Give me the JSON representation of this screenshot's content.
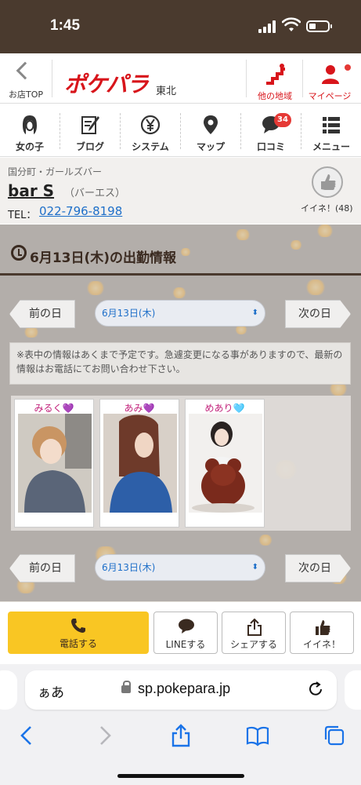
{
  "status_bar": {
    "time": "1:45"
  },
  "header": {
    "back_label": "お店TOP",
    "logo": "ポケパラ",
    "region": "東北",
    "other_region_label": "他の地域",
    "mypage_label": "マイページ"
  },
  "nav": {
    "items": [
      {
        "label": "女の子",
        "icon": "girl-icon"
      },
      {
        "label": "ブログ",
        "icon": "blog-icon"
      },
      {
        "label": "システム",
        "icon": "yen-icon"
      },
      {
        "label": "マップ",
        "icon": "map-pin-icon"
      },
      {
        "label": "口コミ",
        "icon": "chat-bubble-icon",
        "badge": "34"
      },
      {
        "label": "メニュー",
        "icon": "menu-list-icon"
      }
    ]
  },
  "shop": {
    "category": "国分町・ガールズバー",
    "name": "bar S",
    "kana": "（バーエス）",
    "tel_label": "TEL：",
    "tel": "022-796-8198",
    "like_label": "イイネ！(48)"
  },
  "schedule": {
    "title": "6月13日(木)の出勤情報",
    "prev_label": "前の日",
    "next_label": "次の日",
    "selected_date": "6月13日(木)",
    "notice": "※表中の情報はあくまで予定です。急遽変更になる事がありますので、最新の情報はお電話にてお問い合わせ下さい。",
    "girls": [
      {
        "name": "みるく",
        "heart": "💜"
      },
      {
        "name": "あみ",
        "heart": "💜"
      },
      {
        "name": "めあり",
        "heart": "🩵"
      }
    ]
  },
  "actions": {
    "call": "電話する",
    "line": "LINEする",
    "share": "シェアする",
    "like": "イイネ！"
  },
  "browser": {
    "aa": "ぁあ",
    "url": "sp.pokepara.jp"
  },
  "colors": {
    "brand_red": "#d8151b",
    "header_brown": "#4a3a2e",
    "call_yellow": "#f9c623",
    "link_blue": "#1e6fc9"
  }
}
